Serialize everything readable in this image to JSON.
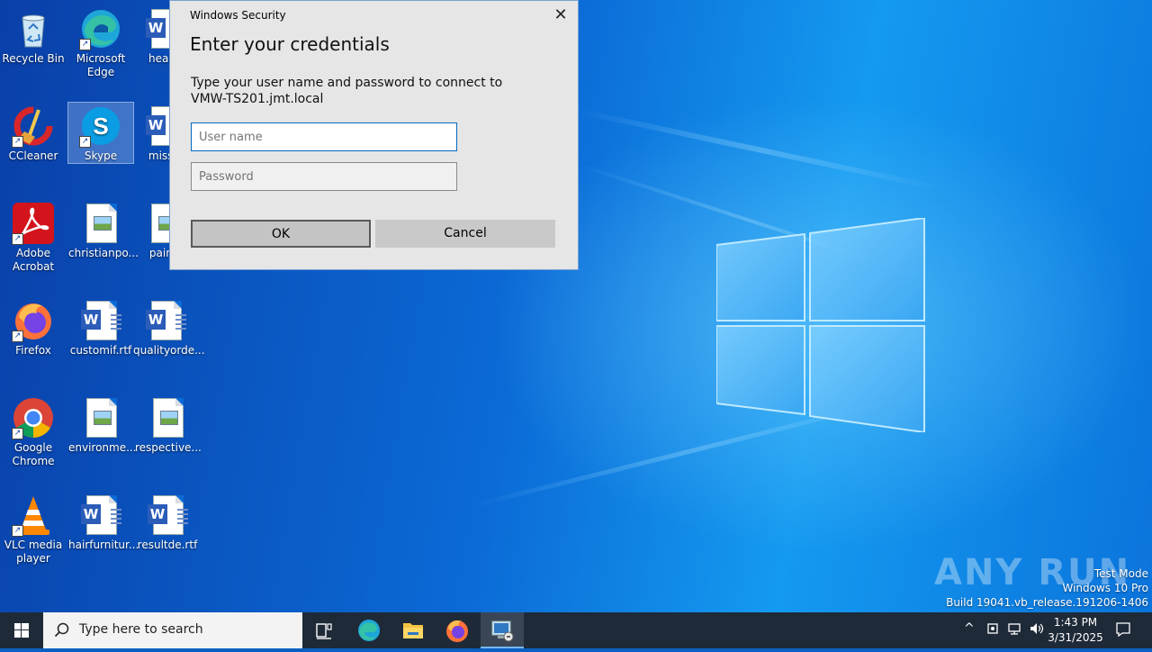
{
  "desktop": {
    "icons": [
      {
        "label": "Recycle Bin"
      },
      {
        "label": "Microsoft Edge"
      },
      {
        "label": "health"
      },
      {
        "label": "CCleaner"
      },
      {
        "label": "Skype"
      },
      {
        "label": "missio"
      },
      {
        "label": "Adobe Acrobat"
      },
      {
        "label": "christianpo..."
      },
      {
        "label": "painki"
      },
      {
        "label": "Firefox"
      },
      {
        "label": "customif.rtf"
      },
      {
        "label": "qualityorde..."
      },
      {
        "label": "Google Chrome"
      },
      {
        "label": "environme..."
      },
      {
        "label": "respective..."
      },
      {
        "label": "VLC media player"
      },
      {
        "label": "hairfurnitur..."
      },
      {
        "label": "resultde.rtf"
      }
    ]
  },
  "dialog": {
    "window_title": "Windows Security",
    "heading": "Enter your credentials",
    "message": "Type your user name and password to connect to VMW-TS201.jmt.local",
    "username_placeholder": "User name",
    "password_placeholder": "Password",
    "ok_label": "OK",
    "cancel_label": "Cancel"
  },
  "watermark": {
    "brand": "ANY RUN",
    "line1": "Test Mode",
    "line2": "Windows 10 Pro",
    "line3": "Build 19041.vb_release.191206-1406"
  },
  "taskbar": {
    "search_placeholder": "Type here to search",
    "time": "1:43 PM",
    "date": "3/31/2025"
  },
  "colors": {
    "accent": "#0067c0",
    "taskbar": "#1e2a38",
    "desktop_blue": "#0b6ad6"
  }
}
